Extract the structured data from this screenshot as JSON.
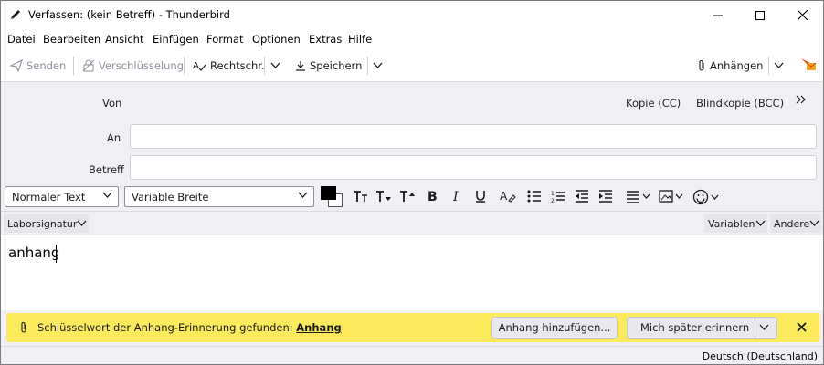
{
  "window": {
    "title": "Verfassen: (kein Betreff) - Thunderbird",
    "controls": {
      "minimize": "minimize",
      "maximize": "maximize",
      "close": "close"
    }
  },
  "menubar": {
    "items": [
      "Datei",
      "Bearbeiten",
      "Ansicht",
      "Einfügen",
      "Format",
      "Optionen",
      "Extras",
      "Hilfe"
    ]
  },
  "toolbar": {
    "send": "Senden",
    "encryption": "Verschlüsselung",
    "spelling": "Rechtschr.",
    "save": "Speichern",
    "attach": "Anhängen"
  },
  "header": {
    "from_label": "Von",
    "cc": "Kopie (CC)",
    "bcc": "Blindkopie (BCC)",
    "to_label": "An",
    "to_value": "",
    "subject_label": "Betreff",
    "subject_value": ""
  },
  "format": {
    "paragraph_style": "Normaler Text",
    "font": "Variable Breite",
    "text_color": "#000000",
    "background_color": "#ffffff"
  },
  "signature_bar": {
    "signature": "Laborsignatur",
    "variables": "Variablen",
    "more": "Andere"
  },
  "body": {
    "text": "anhang"
  },
  "notification": {
    "message": "Schlüsselwort der Anhang-Erinnerung gefunden:",
    "keyword": "Anhang",
    "add_attachment": "Anhang hinzufügen...",
    "remind_later": "Mich später erinnern",
    "background": "#fbeb5c"
  },
  "statusbar": {
    "language": "Deutsch (Deutschland)"
  }
}
